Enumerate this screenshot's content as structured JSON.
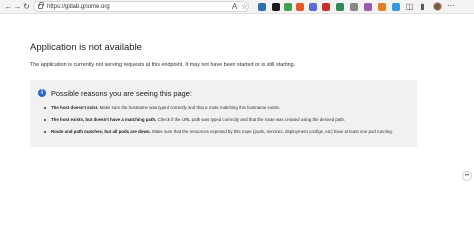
{
  "browser": {
    "url": "https://gitlab.gnome.org",
    "icons": {
      "back": "back-arrow-icon",
      "forward": "forward-arrow-icon",
      "reload": "reload-icon"
    },
    "extension_colors": [
      "#2f6fb0",
      "#1a1a1a",
      "#3fa34d",
      "#e8572a",
      "#5b6cd6",
      "#c9302c",
      "#2e8b57",
      "#888888",
      "#9b59b6",
      "#e67e22",
      "#3498db"
    ]
  },
  "page": {
    "title": "Application is not available",
    "subtitle": "The application is currently not serving requests at this endpoint. It may not have been started or is still starting.",
    "panel": {
      "heading": "Possible reasons you are seeing this page:",
      "reasons": [
        {
          "bold": "The host doesn't exist.",
          "text": " Make sure the hostname was typed correctly and that a route matching this hostname exists."
        },
        {
          "bold": "The host exists, but doesn't have a matching path.",
          "text": " Check if the URL path was typed correctly and that the route was created using the desired path."
        },
        {
          "bold": "Route and path matches, but all pods are down.",
          "text": " Make sure that the resources exposed by this route (pods, services, deployment configs, etc) have at least one pod running."
        }
      ]
    }
  }
}
